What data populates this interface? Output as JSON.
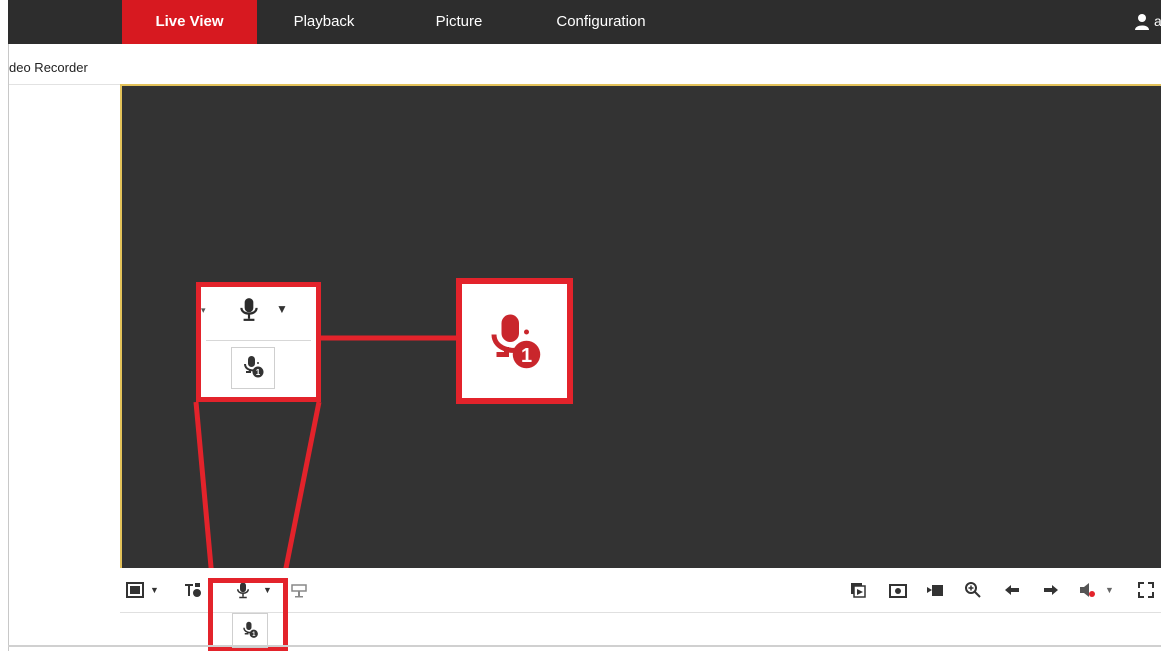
{
  "nav": {
    "tabs": [
      {
        "label": "Live View",
        "active": true
      },
      {
        "label": "Playback",
        "active": false
      },
      {
        "label": "Picture",
        "active": false
      },
      {
        "label": "Configuration",
        "active": false
      }
    ],
    "user_icon": "user-icon",
    "user_trail": "a"
  },
  "sidebar": {
    "device_title": "deo Recorder"
  },
  "colors": {
    "topbar": "#2d2d2d",
    "accent": "#d71920",
    "highlight": "#e3232b",
    "viewer_bg": "#333333",
    "viewer_border": "#e3c25a"
  },
  "toolbar": {
    "left_icons": [
      "window-layout-icon",
      "dropdown-arrow-icon",
      "stream-select-icon",
      "microphone-icon",
      "dropdown-arrow-icon",
      "ptz-icon"
    ],
    "right_icons": [
      "start-all-live-icon",
      "capture-icon",
      "record-icon",
      "digital-zoom-icon",
      "previous-page-icon",
      "next-page-icon",
      "audio-icon",
      "dropdown-arrow-icon",
      "fullscreen-icon"
    ],
    "popup_icon": "two-way-audio-channel-1-icon"
  },
  "callout": {
    "annotation_icons": [
      "microphone-icon",
      "dropdown-arrow-icon",
      "two-way-audio-channel-1-icon"
    ]
  }
}
